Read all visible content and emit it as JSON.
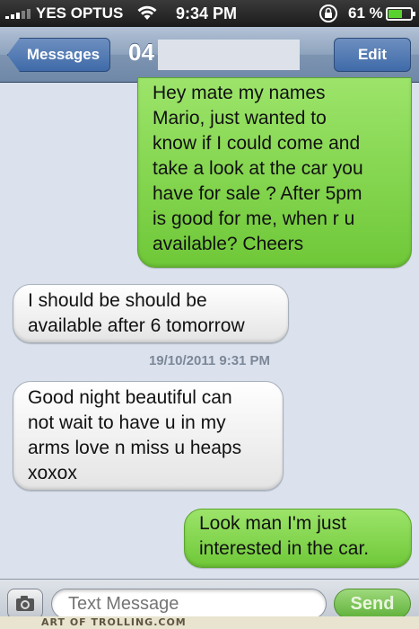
{
  "status_bar": {
    "carrier": "YES OPTUS",
    "time": "9:34 PM",
    "battery_pct": "61 %",
    "battery_level": 0.61,
    "signal_icon": "signal-bars-icon",
    "wifi_icon": "wifi-icon",
    "lock_icon": "rotation-lock-icon",
    "battery_icon": "battery-icon"
  },
  "nav": {
    "back_label": "Messages",
    "contact": "04",
    "edit_label": "Edit"
  },
  "messages": [
    {
      "direction": "outgoing",
      "lines": [
        "Hey mate my names",
        "Mario, just wanted to",
        "know if I could come and",
        "take a look at the car you",
        "have for sale ? After 5pm",
        "is good for me, when r u",
        "available? Cheers"
      ]
    },
    {
      "direction": "incoming",
      "lines": [
        "I should be should be",
        "available after 6 tomorrow"
      ]
    },
    {
      "direction": "incoming",
      "lines": [
        "Good night beautiful can",
        "not wait to have u in my",
        "arms love n miss u heaps",
        "xoxox"
      ]
    },
    {
      "direction": "outgoing",
      "lines": [
        "Look man I'm just",
        "interested in the car."
      ]
    }
  ],
  "timestamp": "19/10/2011 9:31 PM",
  "composer": {
    "placeholder": "Text Message",
    "send_label": "Send",
    "camera_icon": "camera-icon"
  },
  "watermark": "ART OF TROLLING.COM",
  "colors": {
    "outgoing_bubble": "#7fd14a",
    "incoming_bubble": "#f2f2f2",
    "nav_bar": "#8ea3bd",
    "background": "#dbe2ed"
  }
}
